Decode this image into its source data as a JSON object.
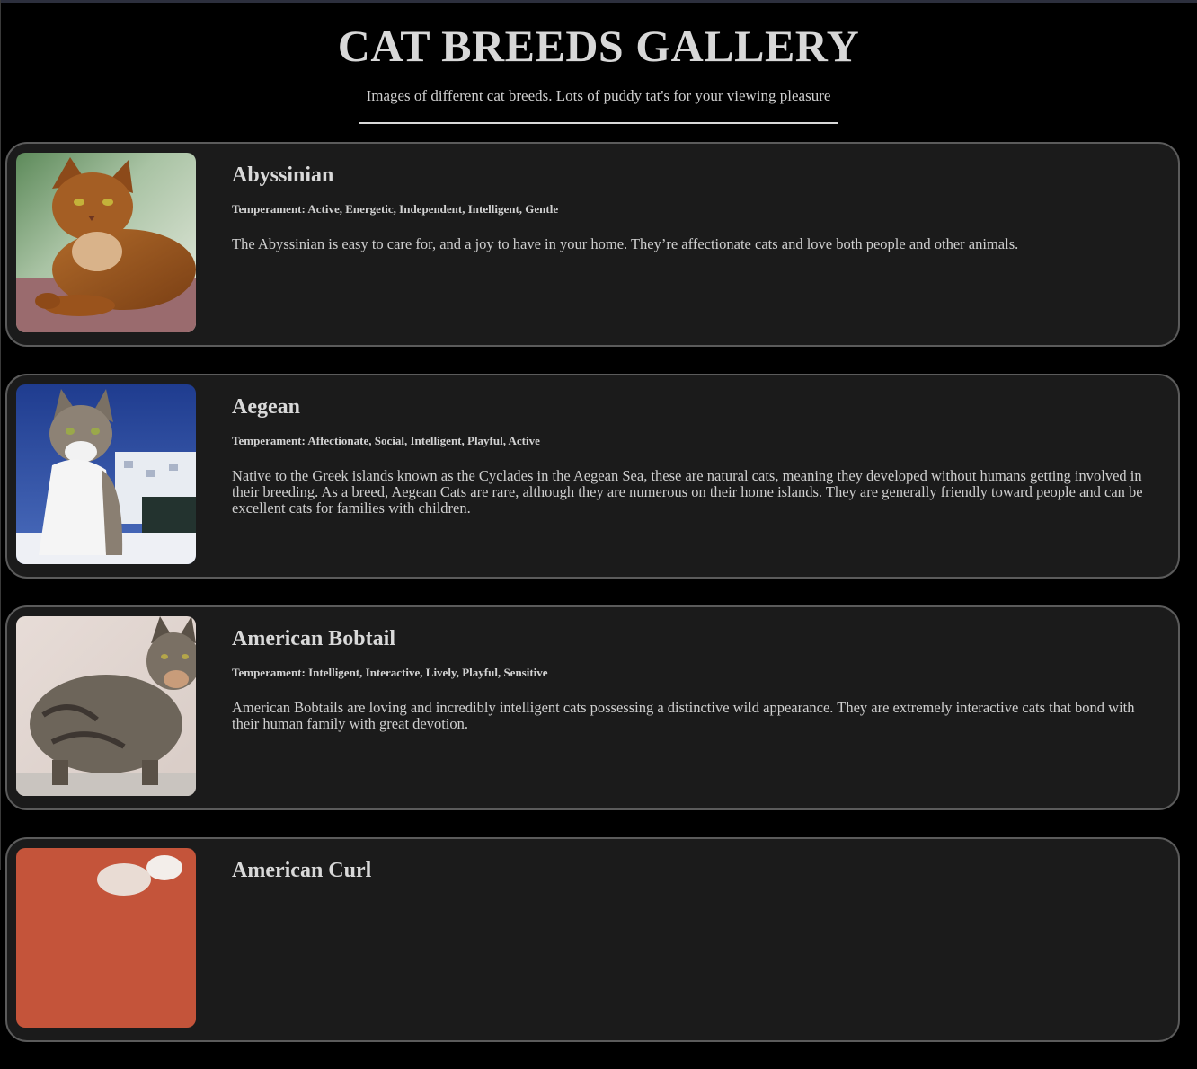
{
  "header": {
    "title": "CAT BREEDS GALLERY",
    "subtitle": "Images of different cat breeds. Lots of puddy tat's for your viewing pleasure"
  },
  "colors": {
    "background": "#000000",
    "card_background": "#1b1b1b",
    "card_border": "#5b5b5b",
    "text": "#d6d6d6"
  },
  "breeds": [
    {
      "name": "Abyssinian",
      "temperament": "Temperament: Active, Energetic, Independent, Intelligent, Gentle",
      "description": "The Abyssinian is easy to care for, and a joy to have in your home. They’re affectionate cats and love both people and other animals.",
      "image_icon": "abyssinian-cat-photo"
    },
    {
      "name": "Aegean",
      "temperament": "Temperament: Affectionate, Social, Intelligent, Playful, Active",
      "description": "Native to the Greek islands known as the Cyclades in the Aegean Sea, these are natural cats, meaning they developed without humans getting involved in their breeding. As a breed, Aegean Cats are rare, although they are numerous on their home islands. They are generally friendly toward people and can be excellent cats for families with children.",
      "image_icon": "aegean-cat-photo"
    },
    {
      "name": "American Bobtail",
      "temperament": "Temperament: Intelligent, Interactive, Lively, Playful, Sensitive",
      "description": "American Bobtails are loving and incredibly intelligent cats possessing a distinctive wild appearance. They are extremely interactive cats that bond with their human family with great devotion.",
      "image_icon": "american-bobtail-cat-photo"
    },
    {
      "name": "American Curl",
      "image_icon": "american-curl-cat-photo"
    }
  ]
}
